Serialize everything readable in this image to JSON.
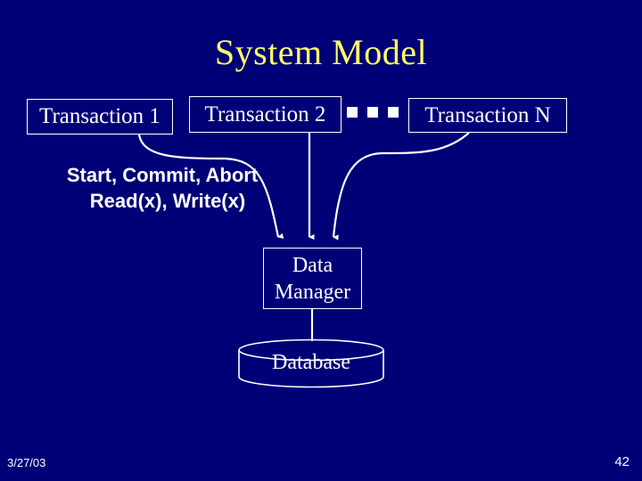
{
  "slide": {
    "title": "System Model",
    "background_color": "#000077",
    "title_color": "#ffff66",
    "line_color": "#ffffff",
    "text_color": "#ffffff"
  },
  "transactions": [
    {
      "label": "Transaction 1"
    },
    {
      "label": "Transaction 2"
    },
    {
      "label": "Transaction N"
    }
  ],
  "ellipsis": {
    "marker": "square",
    "count": 3
  },
  "operations": {
    "line1": "Start, Commit, Abort",
    "line2": "Read(x), Write(x)"
  },
  "data_manager": {
    "line1": "Data",
    "line2": "Manager"
  },
  "database": {
    "label": "Database"
  },
  "footer": {
    "date": "3/27/03",
    "page_number": "42"
  }
}
